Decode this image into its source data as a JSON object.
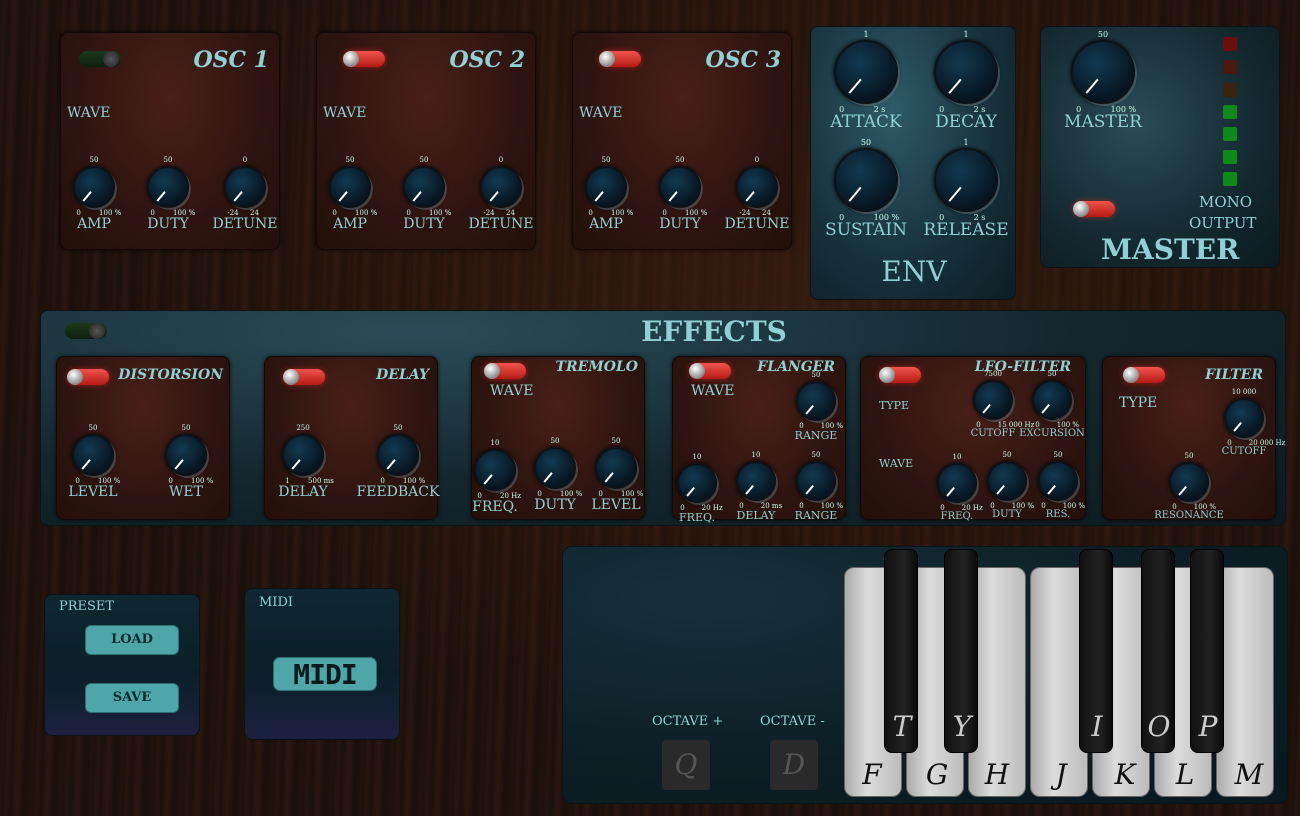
{
  "osc": [
    {
      "title": "OSC 1",
      "wave": "WAVE",
      "knobs": [
        {
          "label": "AMP",
          "top": "50",
          "min": "0",
          "max": "100 %"
        },
        {
          "label": "DUTY",
          "top": "50",
          "min": "0",
          "max": "100 %"
        },
        {
          "label": "DETUNE",
          "top": "0",
          "min": "-24",
          "max": "24"
        }
      ]
    },
    {
      "title": "OSC 2",
      "wave": "WAVE",
      "knobs": [
        {
          "label": "AMP",
          "top": "50",
          "min": "0",
          "max": "100 %"
        },
        {
          "label": "DUTY",
          "top": "50",
          "min": "0",
          "max": "100 %"
        },
        {
          "label": "DETUNE",
          "top": "0",
          "min": "-24",
          "max": "24"
        }
      ]
    },
    {
      "title": "OSC 3",
      "wave": "WAVE",
      "knobs": [
        {
          "label": "AMP",
          "top": "50",
          "min": "0",
          "max": "100 %"
        },
        {
          "label": "DUTY",
          "top": "50",
          "min": "0",
          "max": "100 %"
        },
        {
          "label": "DETUNE",
          "top": "0",
          "min": "-24",
          "max": "24"
        }
      ]
    }
  ],
  "env": {
    "title": "ENV",
    "knobs": [
      {
        "label": "ATTACK",
        "top": "1",
        "min": "0",
        "max": "2 s"
      },
      {
        "label": "DECAY",
        "top": "1",
        "min": "0",
        "max": "2 s"
      },
      {
        "label": "SUSTAIN",
        "top": "50",
        "min": "0",
        "max": "100 %"
      },
      {
        "label": "RELEASE",
        "top": "1",
        "min": "0",
        "max": "2 s"
      }
    ]
  },
  "master": {
    "title": "MASTER",
    "knob_label": "MASTER",
    "top": "50",
    "min": "0",
    "max": "100 %",
    "output_line1": "MONO",
    "output_line2": "OUTPUT"
  },
  "effects": {
    "title": "EFFECTS",
    "distortion": {
      "title": "DISTORSION",
      "knobs": [
        {
          "label": "LEVEL",
          "top": "50",
          "min": "0",
          "max": "100 %"
        },
        {
          "label": "WET",
          "top": "50",
          "min": "0",
          "max": "100 %"
        }
      ]
    },
    "delay": {
      "title": "DELAY",
      "knobs": [
        {
          "label": "DELAY",
          "top": "250",
          "min": "1",
          "max": "500 ms"
        },
        {
          "label": "FEEDBACK",
          "top": "50",
          "min": "0",
          "max": "100 %"
        }
      ]
    },
    "tremolo": {
      "title": "TREMOLO",
      "wave": "WAVE",
      "knobs": [
        {
          "label": "FREQ.",
          "top": "10",
          "min": "0",
          "max": "20 Hz"
        },
        {
          "label": "DUTY",
          "top": "50",
          "min": "0",
          "max": "100 %"
        },
        {
          "label": "LEVEL",
          "top": "50",
          "min": "0",
          "max": "100 %"
        }
      ]
    },
    "flanger": {
      "title": "FLANGER",
      "wave": "WAVE",
      "knobs": [
        {
          "label": "RANGE",
          "top": "50",
          "min": "0",
          "max": "100 %"
        },
        {
          "label": "FREQ.",
          "top": "10",
          "min": "0",
          "max": "20 Hz"
        },
        {
          "label": "DELAY",
          "top": "10",
          "min": "0",
          "max": "20 ms"
        },
        {
          "label": "RANGE",
          "top": "50",
          "min": "0",
          "max": "100 %"
        }
      ]
    },
    "lfo": {
      "title": "LFO-FILTER",
      "type": "TYPE",
      "wave": "WAVE",
      "knobs": [
        {
          "label": "CUTOFF",
          "top": "7500",
          "min": "0",
          "max": "15 000 Hz"
        },
        {
          "label": "EXCURSION",
          "top": "50",
          "min": "0",
          "max": "100 %"
        },
        {
          "label": "FREQ.",
          "top": "10",
          "min": "0",
          "max": "20 Hz"
        },
        {
          "label": "DUTY",
          "top": "50",
          "min": "0",
          "max": "100 %"
        },
        {
          "label": "RES.",
          "top": "50",
          "min": "0",
          "max": "100 %"
        }
      ]
    },
    "filter": {
      "title": "FILTER",
      "type": "TYPE",
      "knobs": [
        {
          "label": "CUTOFF",
          "top": "10 000",
          "min": "0",
          "max": "20 000 Hz"
        },
        {
          "label": "RESONANCE",
          "top": "50",
          "min": "0",
          "max": "100 %"
        }
      ]
    }
  },
  "preset": {
    "title": "PRESET",
    "load": "LOAD",
    "save": "SAVE"
  },
  "midi": {
    "title": "MIDI",
    "logo": "MIDI"
  },
  "keyboard": {
    "octave_up": "OCTAVE +",
    "octave_down": "OCTAVE -",
    "octave_up_key": "Q",
    "octave_down_key": "D",
    "white": [
      "F",
      "G",
      "H",
      "J",
      "K",
      "L",
      "M"
    ],
    "black": [
      "T",
      "Y",
      "I",
      "O",
      "P"
    ]
  },
  "colors": {
    "accent": "#8fd0d4",
    "toggle_on": "#e0342c",
    "led_green": "#1aa21a",
    "led_red": "#7a1010"
  }
}
